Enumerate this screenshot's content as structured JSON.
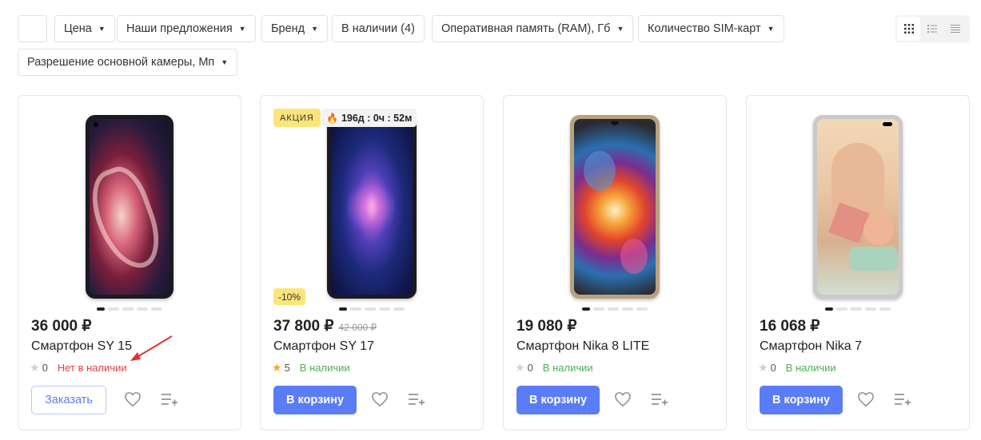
{
  "filters": {
    "empty_chip": "",
    "items": [
      {
        "label": "Цена"
      },
      {
        "label": "Наши предложения"
      },
      {
        "label": "Бренд"
      },
      {
        "label": "В наличии (4)"
      },
      {
        "label": "Оперативная память (RAM), Гб"
      },
      {
        "label": "Количество SIM-карт"
      },
      {
        "label": "Разрешение основной камеры, Мп"
      }
    ]
  },
  "view_toggle": {
    "icons": [
      "grid-view-icon",
      "list-view-icon",
      "compact-list-view-icon"
    ],
    "active": 0
  },
  "products": [
    {
      "price": "36 000 ₽",
      "old_price": "",
      "name": "Смартфон SY 15",
      "rating": "0",
      "stock": "Нет в наличии",
      "in_stock": false,
      "button": "Заказать",
      "badges": {}
    },
    {
      "price": "37 800 ₽",
      "old_price": "42 000 ₽",
      "name": "Смартфон SY 17",
      "rating": "5",
      "stock": "В наличии",
      "in_stock": true,
      "button": "В корзину",
      "badges": {
        "sale": "АКЦИЯ",
        "timer": "196д : 0ч : 52м",
        "discount": "-10%"
      }
    },
    {
      "price": "19 080 ₽",
      "old_price": "",
      "name": "Смартфон Nika 8 LITE",
      "rating": "0",
      "stock": "В наличии",
      "in_stock": true,
      "button": "В корзину",
      "badges": {}
    },
    {
      "price": "16 068 ₽",
      "old_price": "",
      "name": "Смартфон Nika 7",
      "rating": "0",
      "stock": "В наличии",
      "in_stock": true,
      "button": "В корзину",
      "badges": {}
    }
  ],
  "colors": {
    "accent": "#5b7cf7",
    "in_stock": "#4caf50",
    "out_of_stock": "#e83b3b",
    "sale_badge": "#fbe57a",
    "annotation_arrow": "#e53030"
  }
}
